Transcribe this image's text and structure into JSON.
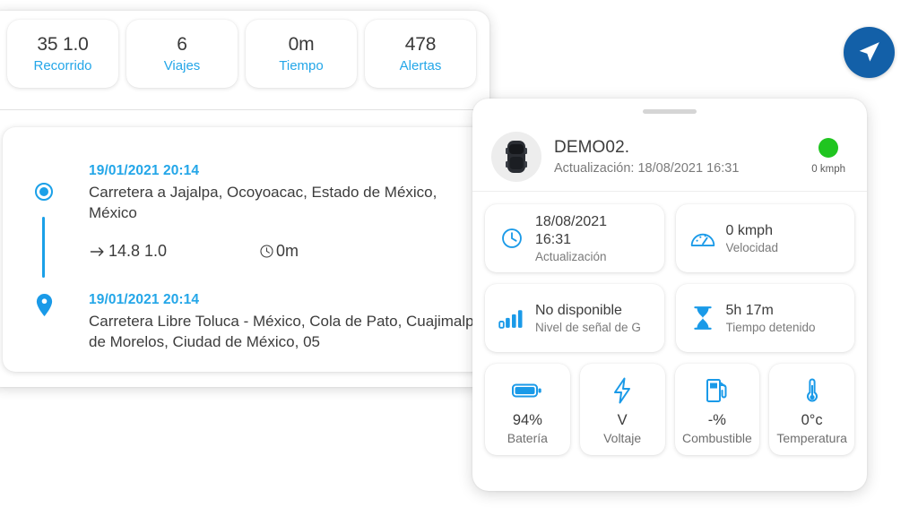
{
  "left_panel": {
    "stats": [
      {
        "value": "35 1.0",
        "label": "Recorrido"
      },
      {
        "value": "6",
        "label": "Viajes"
      },
      {
        "value": "0m",
        "label": "Tiempo"
      },
      {
        "value": "478",
        "label": "Alertas"
      }
    ],
    "trip": {
      "start": {
        "time": "19/01/2021 20:14",
        "address": "Carretera a Jajalpa, Ocoyoacac, Estado de México, México",
        "marker_icon": "start-circle-icon"
      },
      "metrics": {
        "distance_icon": "arrow-right-icon",
        "distance": "14.8 1.0",
        "duration_icon": "clock-icon",
        "duration": "0m",
        "play_icon": "play-circle-icon"
      },
      "end": {
        "time": "19/01/2021 20:14",
        "address": "Carretera Libre Toluca - México, Cola de Pato, Cuajimalpa de Morelos, Ciudad de México, 05",
        "marker_icon": "map-pin-icon"
      }
    }
  },
  "right_panel": {
    "handle_icon": "drag-handle-icon",
    "device": {
      "avatar_icon": "vehicle-icon",
      "name": "DEMO02.",
      "update_text": "Actualización: 18/08/2021 16:31",
      "status_icon": "status-dot-icon",
      "status_color": "#20c520",
      "speed": "0 kmph"
    },
    "info_cards": [
      {
        "icon": "clock-icon",
        "value": "18/08/2021\n16:31",
        "label": "Actualización"
      },
      {
        "icon": "speedometer-icon",
        "value": "0 kmph",
        "label": "Velocidad"
      },
      {
        "icon": "signal-bars-icon",
        "value": "No disponible",
        "label": "Nivel de señal de G"
      },
      {
        "icon": "hourglass-icon",
        "value": "5h 17m",
        "label": "Tiempo detenido"
      }
    ],
    "metric_cards": [
      {
        "icon": "battery-icon",
        "value": "94%",
        "label": "Batería"
      },
      {
        "icon": "bolt-icon",
        "value": "V",
        "label": "Voltaje"
      },
      {
        "icon": "fuel-pump-icon",
        "value": "-%",
        "label": "Combustible"
      },
      {
        "icon": "thermometer-icon",
        "value": "0°c",
        "label": "Temperatura"
      }
    ]
  },
  "fab": {
    "icon": "navigation-arrow-icon",
    "color": "#1360a8"
  },
  "colors": {
    "accent_blue": "#23a6e8",
    "icon_blue": "#1a9ae8",
    "fab_blue": "#1360a8",
    "status_green": "#20c520",
    "text_dark": "#3c3c3c",
    "text_muted": "#7a7a7a"
  }
}
